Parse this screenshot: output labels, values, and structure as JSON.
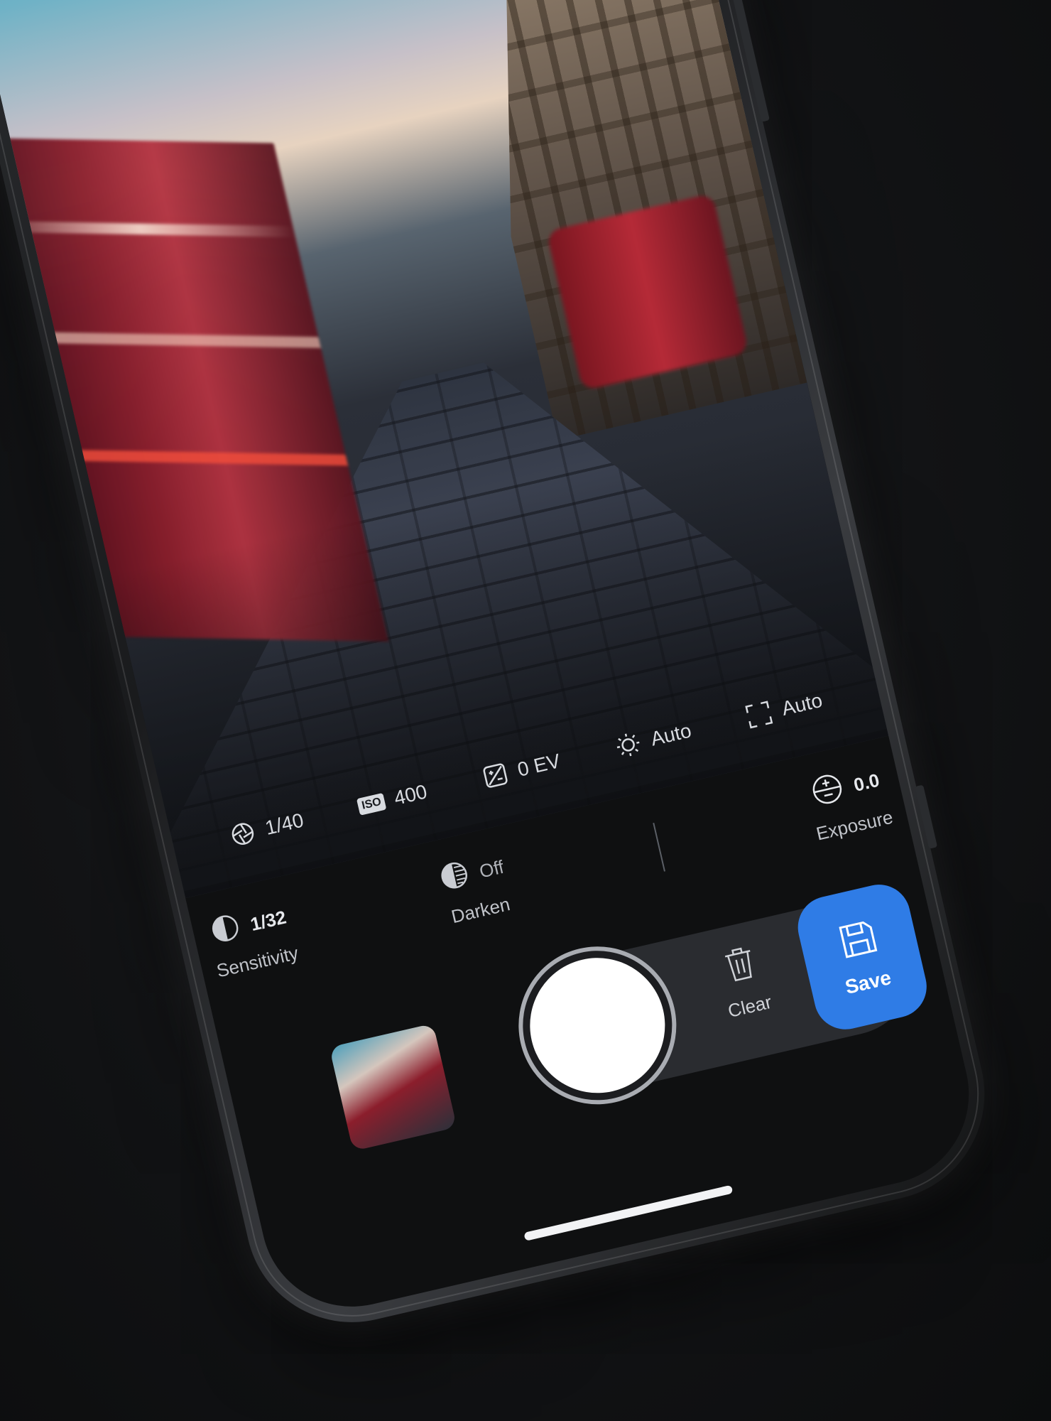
{
  "settings_strip": {
    "shutter_speed": "1/40",
    "iso_badge": "ISO",
    "iso_value": "400",
    "exposure_comp": "0 EV",
    "white_balance": "Auto",
    "focus": "Auto"
  },
  "controls": {
    "sensitivity": {
      "value": "1/32",
      "label": "Sensitivity"
    },
    "darken": {
      "value": "Off",
      "label": "Darken"
    },
    "exposure": {
      "value": "0.0",
      "label": "Exposure"
    }
  },
  "actions": {
    "clear_label": "Clear",
    "save_label": "Save"
  },
  "colors": {
    "accent": "#2f7ce6",
    "bus_red": "#b52a37"
  }
}
